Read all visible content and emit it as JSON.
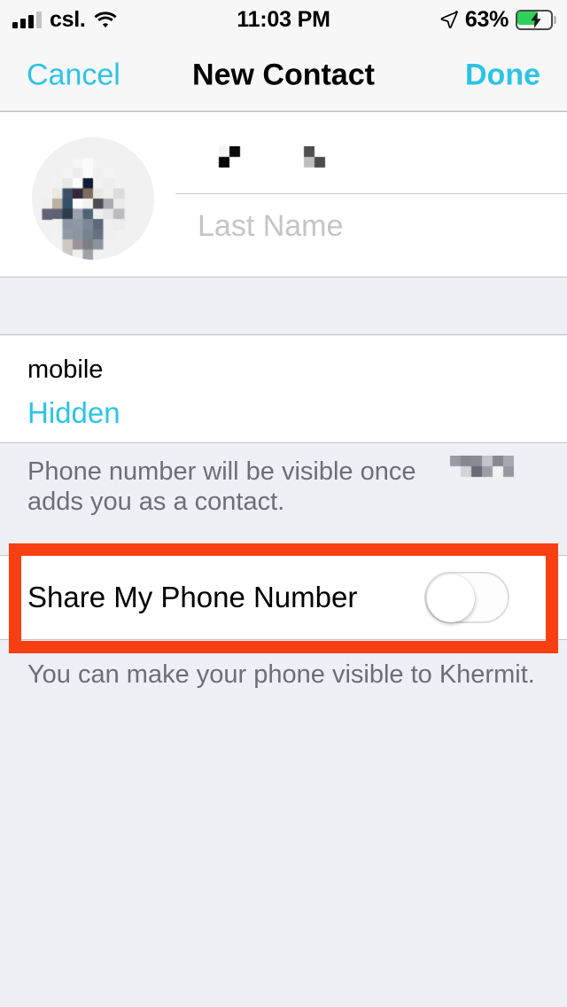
{
  "status_bar": {
    "carrier": "csl.",
    "time": "11:03 PM",
    "battery_percent": "63%",
    "signal_bars_filled": 3,
    "signal_bars_total": 4,
    "wifi_icon": "wifi-icon",
    "location_icon": "location-arrow-icon",
    "battery_icon": "battery-charging-icon",
    "charging": true
  },
  "nav_bar": {
    "cancel_label": "Cancel",
    "title": "New Contact",
    "done_label": "Done"
  },
  "contact": {
    "avatar_label": "contact photo",
    "first_name_value": "",
    "first_name_redacted": true,
    "last_name_placeholder": "Last Name"
  },
  "phone": {
    "type_label": "mobile",
    "value": "Hidden"
  },
  "footnote_1": {
    "line_1": "Phone number will be visible once",
    "line_2": "adds you as a contact.",
    "redacted_name": true
  },
  "share_row": {
    "label": "Share My Phone Number",
    "toggle_state": "off"
  },
  "footnote_2": {
    "text": "You can make your phone visible to Khermit."
  },
  "annotation": {
    "highlight_color": "#f83f12",
    "target": "share-my-phone-number-row"
  },
  "colors": {
    "accent": "#2cc4e6",
    "background": "#eff0f5",
    "card": "#ffffff",
    "nav_background": "#f7f7f7",
    "battery_green": "#2fd159",
    "secondary_text": "#6e6e78",
    "placeholder_text": "#c4c4ca"
  }
}
